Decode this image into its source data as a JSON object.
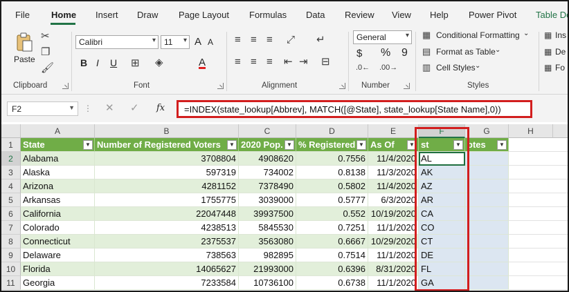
{
  "menu": {
    "tabs": [
      "File",
      "Home",
      "Insert",
      "Draw",
      "Page Layout",
      "Formulas",
      "Data",
      "Review",
      "View",
      "Help",
      "Power Pivot",
      "Table De"
    ],
    "active": "Home"
  },
  "ribbon": {
    "clipboard": {
      "label": "Clipboard",
      "paste_label": "Paste"
    },
    "font": {
      "label": "Font",
      "font_name": "Calibri",
      "font_size": "11",
      "bold": "B",
      "italic": "I",
      "underline": "U",
      "font_color_letter": "A",
      "grow": "A",
      "shrink": "A"
    },
    "alignment": {
      "label": "Alignment"
    },
    "number": {
      "label": "Number",
      "format": "General",
      "currency": "$",
      "percent": "%",
      "comma": "9"
    },
    "styles": {
      "label": "Styles",
      "conditional": "Conditional Formatting",
      "format_table": "Format as Table",
      "cell_styles": "Cell Styles"
    },
    "cells": {
      "insert": "Ins",
      "delete": "De",
      "format": "Fo"
    }
  },
  "formula_bar": {
    "name_box": "F2",
    "fx": "fx",
    "formula": "=INDEX(state_lookup[Abbrev], MATCH([@State], state_lookup[State Name],0))"
  },
  "grid": {
    "columns": [
      "A",
      "B",
      "C",
      "D",
      "E",
      "F",
      "G",
      "H"
    ],
    "headers": [
      "State",
      "Number of Registered Voters",
      "2020 Pop.",
      "% Registered",
      "As Of",
      "st",
      "Notes"
    ],
    "header_visible": [
      "State",
      "Number of Registered Voters",
      "2020 Pop.",
      "% Registered",
      "As Of",
      "st",
      "otes"
    ],
    "row_numbers": [
      "1",
      "2",
      "3",
      "4",
      "5",
      "6",
      "7",
      "8",
      "9",
      "10",
      "11"
    ],
    "rows": [
      [
        "Alabama",
        "3708804",
        "4908620",
        "0.7556",
        "11/4/2020",
        "AL",
        ""
      ],
      [
        "Alaska",
        "597319",
        "734002",
        "0.8138",
        "11/3/2020",
        "AK",
        ""
      ],
      [
        "Arizona",
        "4281152",
        "7378490",
        "0.5802",
        "11/4/2020",
        "AZ",
        ""
      ],
      [
        "Arkansas",
        "1755775",
        "3039000",
        "0.5777",
        "6/3/2020",
        "AR",
        ""
      ],
      [
        "California",
        "22047448",
        "39937500",
        "0.552",
        "10/19/2020",
        "CA",
        ""
      ],
      [
        "Colorado",
        "4238513",
        "5845530",
        "0.7251",
        "11/1/2020",
        "CO",
        ""
      ],
      [
        "Connecticut",
        "2375537",
        "3563080",
        "0.6667",
        "10/29/2020",
        "CT",
        ""
      ],
      [
        "Delaware",
        "738563",
        "982895",
        "0.7514",
        "11/1/2020",
        "DE",
        ""
      ],
      [
        "Florida",
        "14065627",
        "21993000",
        "0.6396",
        "8/31/2020",
        "FL",
        ""
      ],
      [
        "Georgia",
        "7233584",
        "10736100",
        "0.6738",
        "11/1/2020",
        "GA",
        ""
      ]
    ]
  },
  "colors": {
    "header_green": "#70ad47",
    "band_green": "#e2efda",
    "selection_blue": "#dce6f1",
    "highlight_red": "#d21e1e",
    "accent": "#217346"
  }
}
